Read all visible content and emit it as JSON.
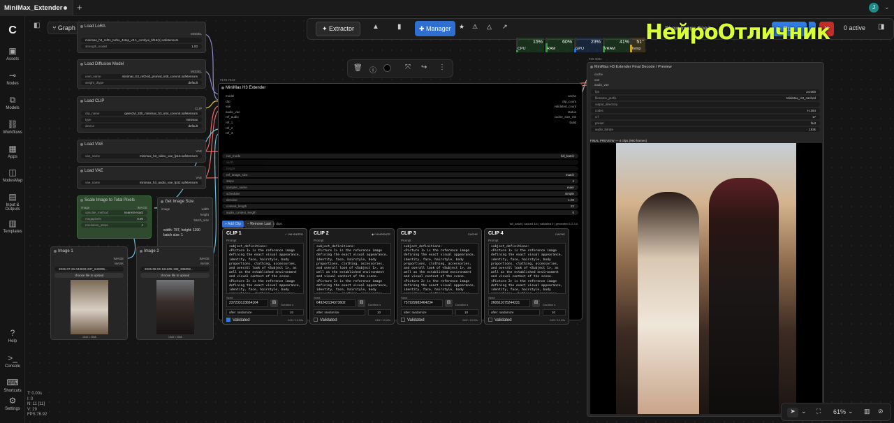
{
  "topbar": {
    "tab_title": "MiniMax_Extender",
    "plus_label": "+",
    "avatar_letter": "J"
  },
  "sidebar": {
    "logo": "C",
    "items": [
      {
        "label": "Assets",
        "icon": "image-stack-icon"
      },
      {
        "label": "Nodes",
        "icon": "plug-icon"
      },
      {
        "label": "Models",
        "icon": "cube-icon"
      },
      {
        "label": "Workflows",
        "icon": "flow-icon"
      },
      {
        "label": "Apps",
        "icon": "app-grid-icon"
      },
      {
        "label": "NodesMap",
        "icon": "map-icon"
      },
      {
        "label": "Input & Outputs",
        "icon": "image-icon"
      },
      {
        "label": "Templates",
        "icon": "template-icon"
      }
    ],
    "bottom": [
      {
        "label": "Help",
        "icon": "question-icon"
      },
      {
        "label": "Console",
        "icon": "terminal-icon"
      },
      {
        "label": "Shortcuts",
        "icon": "keyboard-icon"
      },
      {
        "label": "Settings",
        "icon": "gear-icon"
      }
    ]
  },
  "canvas_toolbar": {
    "mode": "Graph"
  },
  "stats": {
    "t": "T: 0.00s",
    "i": "I: 0",
    "n": "N: 11 [11]",
    "v": "V: 29",
    "fps": "FPS:76.92"
  },
  "main_toolbar": {
    "extractor": "Extractor",
    "manager": "Manager",
    "run": "Run",
    "active": "0 active",
    "meters": [
      {
        "label": "CPU",
        "pct": "15%",
        "value": 0.15,
        "color": "#2e9e3a"
      },
      {
        "label": "RAM",
        "pct": "60%",
        "value": 0.6,
        "color": "#2e9e3a"
      },
      {
        "label": "GPU",
        "pct": "23%",
        "value": 0.23,
        "color": "#2f6fd0"
      },
      {
        "label": "VRAM",
        "pct": "41%",
        "value": 0.41,
        "color": "#2e9e3a"
      },
      {
        "label": "Temp",
        "pct": "51°",
        "value": 0.51,
        "color": "#c9a227"
      }
    ],
    "show_image_feed": "Show Image Feed"
  },
  "watermark": "НейроОтличник",
  "nodes": {
    "lora": {
      "title": "Load LoRA",
      "out": "MODEL",
      "w1": "minimax_h3_ref2v_turbo_4step_v0.1_comfyui_bf16(1).safetensors",
      "w2_label": "strength_model",
      "w2_val": "1.00"
    },
    "diffusion": {
      "title": "Load Diffusion Model",
      "out": "MODEL",
      "w1_label": "unet_name",
      "w1_val": "minimax_h3_ref2vid_pruned_int8_convrot.safetensors",
      "w2_label": "weight_dtype",
      "w2_val": "default"
    },
    "clip": {
      "title": "Load CLIP",
      "out": "CLIP",
      "w1_label": "clip_name",
      "w1_val": "qwen3vl_32b_minimax_h3_int4_convrot.safetensors",
      "w2_label": "type",
      "w2_val": "minimax",
      "w3_label": "device",
      "w3_val": "default"
    },
    "vae1": {
      "title": "Load VAE",
      "out": "VAE",
      "w1_label": "vae_name",
      "w1_val": "minimax_h3_video_vae_fp16.safetensors"
    },
    "vae2": {
      "title": "Load VAE",
      "out": "VAE",
      "w1_label": "vae_name",
      "w1_val": "minimax_h3_audio_vae_fp32.safetensors"
    },
    "scale": {
      "title": "Scale Image to Total Pixels",
      "in": "image",
      "out": "IMAGE",
      "w1_label": "upscale_method",
      "w1_val": "nearest-exact",
      "w2_label": "megapixels",
      "w2_val": "0.90",
      "w3_label": "resolution_steps",
      "w3_val": "1"
    },
    "size": {
      "title": "Get Image Size",
      "in": "image",
      "o1": "width",
      "o2": "height",
      "o3": "batch_size",
      "text1": "width: 787, height: 1190",
      "text2": "batch size: 1"
    },
    "img1": {
      "title": "Image 1",
      "o1": "IMAGE",
      "o2": "MASK",
      "file": "2026-07-26-043833-237_643095...",
      "btn": "choose file to upload",
      "dim": "1344 × 2048"
    },
    "img2": {
      "title": "Image 2",
      "o1": "IMAGE",
      "o2": "MASK",
      "file": "2026-08-02-161605-198_336092...",
      "btn": "choose file to upload",
      "dim": "1344 × 2048"
    }
  },
  "extender": {
    "badge": "#173 7043",
    "title": "MiniMax H3 Extender",
    "inputs": [
      "model",
      "clip",
      "vae",
      "audio_vae",
      "ref_audio",
      "ref_1",
      "ref_2",
      "ref_3"
    ],
    "outputs": [
      "cache",
      "clip_count",
      "validated_count",
      "status",
      "cache_size_mb",
      "build"
    ],
    "widgets": [
      {
        "label": "run_mode",
        "val": "full_batch"
      },
      {
        "label": "width",
        "val": ""
      },
      {
        "label": "height",
        "val": ""
      },
      {
        "label": "ref_image_size",
        "val": "match"
      },
      {
        "label": "steps",
        "val": "4"
      },
      {
        "label": "sampler_name",
        "val": "euler"
      },
      {
        "label": "scheduler",
        "val": "simple"
      },
      {
        "label": "denoise",
        "val": "1.00"
      },
      {
        "label": "context_length",
        "val": "22"
      },
      {
        "label": "audio_context_length",
        "val": "0"
      }
    ],
    "add_clip": "+ Add Clip",
    "remove_last": "− Remove Last",
    "clips_count": "4 clips",
    "status_line": "full_batch | cached 4/4 | validated 0 | generated 1,2,3,4",
    "prompt_text": "subject_definitions:\n<Picture 1> is the reference image defining the exact visual appearance, identity, face, hairstyle, body proportions, clothing, accessories, and overall look of <Subject 1>, as well as the established environment and visual context of the scene.\n<Picture 2> is the reference image defining the exact visual appearance, identity, face, hairstyle, body proportions, clothing, accessories, and",
    "clips": [
      {
        "name": "CLIP 1",
        "state": "✓ VALIDATED",
        "prompt_label": "Prompt",
        "seed_label": "Seed",
        "seed": "237233123664164",
        "dur_label": "Duration s",
        "dur": "10",
        "after": "after: randomize",
        "validated": "Validated",
        "checked": true,
        "frames": "241f / 10.02s"
      },
      {
        "name": "CLIP 2",
        "state": "◆ CANDIDATE",
        "prompt_label": "Prompt",
        "seed_label": "Seed",
        "seed": "649242134373602",
        "dur_label": "Duration s",
        "dur": "10",
        "after": "after: randomize",
        "validated": "Validated",
        "checked": false,
        "frames": "240f / 10.02s"
      },
      {
        "name": "CLIP 3",
        "state": "CACHE",
        "prompt_label": "Prompt",
        "seed_label": "Seed",
        "seed": "757929983464234",
        "dur_label": "Duration s",
        "dur": "10",
        "after": "after: randomize",
        "validated": "Validated",
        "checked": false,
        "frames": "240f / 10.02s"
      },
      {
        "name": "CLIP 4",
        "state": "CACHE",
        "prompt_label": "Prompt",
        "seed_label": "Seed",
        "seed": "260611075244331",
        "dur_label": "Duration s",
        "dur": "10",
        "after": "after: randomize",
        "validated": "Validated",
        "checked": false,
        "frames": "240f / 10.02s"
      }
    ]
  },
  "decode": {
    "badge": "#29 306s",
    "title": "MiniMax H3 Extender Final Decode / Preview",
    "inputs": [
      "cache",
      "vae",
      "audio_vae"
    ],
    "widgets": [
      {
        "label": "fps",
        "val": "24.000"
      },
      {
        "label": "filename_prefix",
        "val": "MiniMax_H3_cached"
      },
      {
        "label": "output_directory",
        "val": ""
      },
      {
        "label": "codec",
        "val": "H.264"
      },
      {
        "label": "crf",
        "val": "17"
      },
      {
        "label": "preset",
        "val": "fast"
      },
      {
        "label": "audio_bitrate",
        "val": "192k"
      }
    ],
    "preview_label": "FINAL PREVIEW — 4 clips (960 frames)"
  },
  "zoom": "61%"
}
